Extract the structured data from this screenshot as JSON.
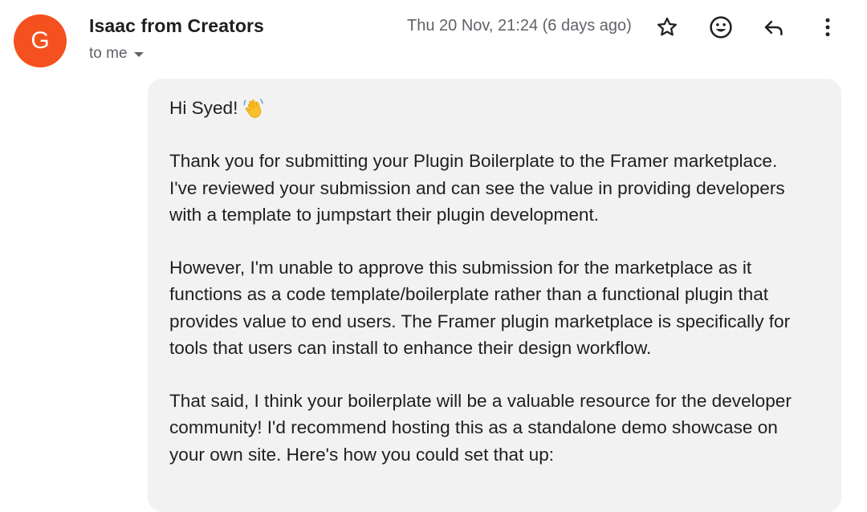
{
  "header": {
    "avatar_letter": "G",
    "sender_name": "Isaac from Creators",
    "recipient_label": "to me",
    "timestamp": "Thu 20 Nov, 21:24 (6 days ago)",
    "actions": [
      "star-icon",
      "emoji-icon",
      "reply-icon",
      "more-vert-icon"
    ]
  },
  "message": {
    "greeting": "Hi Syed!",
    "greeting_emoji": "waving-hand",
    "paragraphs": [
      {
        "lines": [
          "Thank you for submitting your Plugin Boilerplate to the Framer marketplace.",
          "I've reviewed your submission and can see the value in providing developers",
          "with a template to jumpstart their plugin development."
        ]
      },
      {
        "lines": [
          "However, I'm unable to approve this submission for the marketplace as it",
          "functions as a code template/boilerplate rather than a functional plugin that",
          "provides value to end users. The Framer plugin marketplace is specifically for",
          "tools that users can install to enhance their design workflow."
        ]
      },
      {
        "lines": [
          "That said, I think your boilerplate will be a valuable resource for the developer",
          "community! I'd recommend hosting this as a standalone demo showcase on",
          "your own site. Here's how you could set that up:"
        ]
      }
    ]
  },
  "colors": {
    "avatar_bg": "#f4511e",
    "bubble_bg": "#f2f2f2",
    "secondary_text": "#5f6368",
    "primary_text": "#1f1f1f"
  }
}
